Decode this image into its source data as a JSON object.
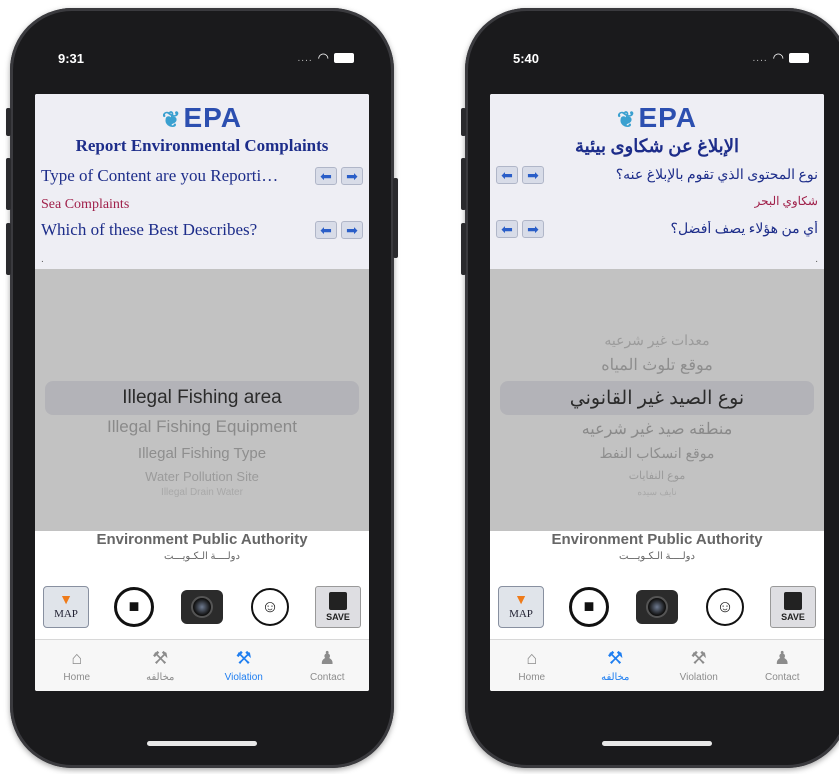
{
  "left_phone": {
    "status_time": "9:31",
    "logo_text": "EPA",
    "title": "Report Environmental Complaints",
    "q1": "Type of Content are you Reporti…",
    "answer1": "Sea Complaints",
    "q2": "Which of these Best Describes?",
    "dot": ".",
    "picker": {
      "selected": "Illegal Fishing area",
      "below": [
        "Illegal Fishing Equipment",
        "Illegal Fishing Type",
        "Water Pollution Site",
        "Illegal Drain Water"
      ]
    },
    "authority": "Environment Public Authority",
    "authority_ar": "دولــــة الـكـويـــت",
    "map_label": "MAP",
    "save_label": "SAVE",
    "tabs": [
      "Home",
      "مخالفه",
      "Violation",
      "Contact"
    ],
    "active_tab": 2
  },
  "right_phone": {
    "status_time": "5:40",
    "logo_text": "EPA",
    "title": "الإبلاغ عن شكاوى بيئية",
    "q1": "نوع المحتوى الذي تقوم بالإبلاغ عنه؟",
    "answer1": "شكاوي البحر",
    "q2": "أي من هؤلاء يصف أفضل؟",
    "dot": ".",
    "picker": {
      "above": [
        "معدات غير شرعيه",
        "موقع تلوث المياه"
      ],
      "selected": "نوع الصيد غير القانوني",
      "below": [
        "منطقه صيد غير شرعيه",
        "موقع انسكاب النفط",
        "موع النفايات",
        "نايف سيده"
      ]
    },
    "authority": "Environment Public Authority",
    "authority_ar": "دولــــة الـكـويـــت",
    "map_label": "MAP",
    "save_label": "SAVE",
    "tabs": [
      "Home",
      "مخالفه",
      "Violation",
      "Contact"
    ],
    "active_tab": 1
  },
  "colors": {
    "accent": "#1f7ef0",
    "title_blue": "#1d2d8a",
    "answer_red": "#a0204a",
    "picker_gray": "#c2c2c2"
  },
  "icons": [
    "leaf-icon",
    "arrow-left-icon",
    "arrow-right-icon",
    "map-pin-icon",
    "video-camera-icon",
    "camera-icon",
    "contact-add-icon",
    "save-disk-icon",
    "home-icon",
    "gavel-icon",
    "user-icon",
    "wifi-icon",
    "battery-icon"
  ]
}
